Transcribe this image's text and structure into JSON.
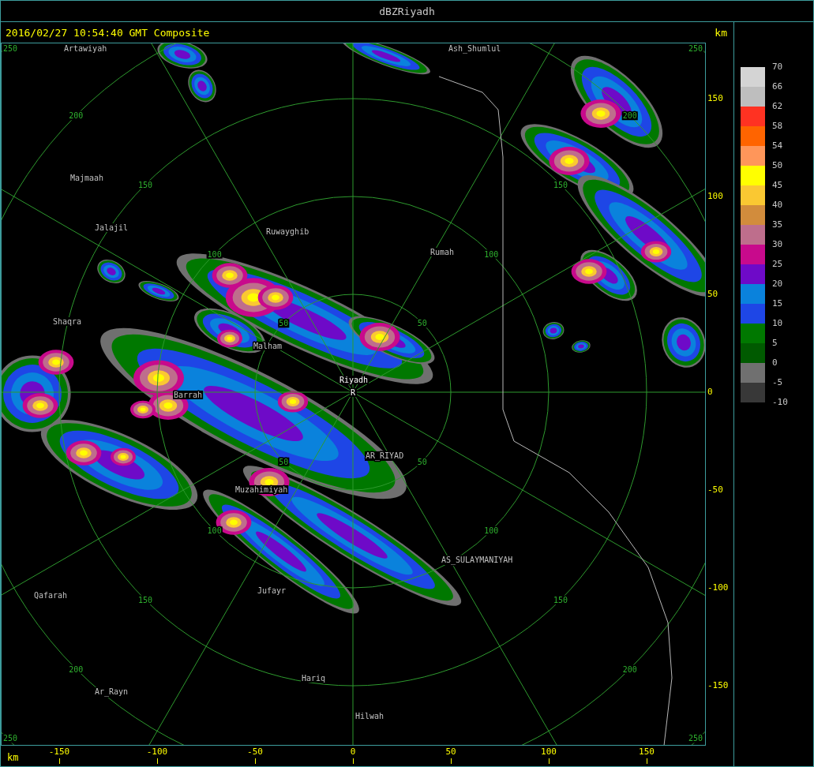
{
  "window": {
    "title": "dBZRiyadh"
  },
  "header": {
    "timestamp": "2016/02/27 10:54:40 GMT Composite",
    "unit": "km"
  },
  "map": {
    "range_rings": [
      {
        "labels": [
          "50",
          "50",
          "50",
          "50"
        ]
      },
      {
        "labels": [
          "100",
          "100",
          "100",
          "100"
        ]
      },
      {
        "labels": [
          "150",
          "150",
          "150",
          "150"
        ]
      },
      {
        "labels": [
          "200",
          "200",
          "200",
          "200"
        ]
      },
      {
        "labels": [
          "250",
          "250",
          "250",
          "250"
        ]
      }
    ],
    "cities": [
      {
        "name": "Artawiyah",
        "kind": "town"
      },
      {
        "name": "Ash_Shumlul",
        "kind": "town"
      },
      {
        "name": "Majmaah",
        "kind": "town"
      },
      {
        "name": "Jalajil",
        "kind": "town"
      },
      {
        "name": "Ruwayghib",
        "kind": "town"
      },
      {
        "name": "Rumah",
        "kind": "town"
      },
      {
        "name": "Shaqra",
        "kind": "town"
      },
      {
        "name": "Malham",
        "kind": "town"
      },
      {
        "name": "Riyadh",
        "kind": "site"
      },
      {
        "name": "Barrah",
        "kind": "town"
      },
      {
        "name": "AR_RIYAD",
        "kind": "town"
      },
      {
        "name": "Muzahimiyah",
        "kind": "town"
      },
      {
        "name": "AS_SULAYMANIYAH",
        "kind": "town"
      },
      {
        "name": "Qafarah",
        "kind": "town"
      },
      {
        "name": "Jufayr",
        "kind": "town"
      },
      {
        "name": "Hariq",
        "kind": "town"
      },
      {
        "name": "Ar_Rayn",
        "kind": "town"
      },
      {
        "name": "Hilwah",
        "kind": "town"
      }
    ],
    "site_marker": "R"
  },
  "y_axis": {
    "ticks": [
      "150",
      "100",
      "50",
      "0",
      "-50",
      "-100",
      "-150"
    ]
  },
  "x_axis": {
    "unit": "km",
    "ticks": [
      "-150",
      "-100",
      "-50",
      "0",
      "50",
      "100",
      "150"
    ]
  },
  "legend": {
    "bins": [
      {
        "color": "#d4d4d4"
      },
      {
        "color": "#bebebe"
      },
      {
        "color": "#ff3222"
      },
      {
        "color": "#ff6400"
      },
      {
        "color": "#ff965a"
      },
      {
        "color": "#ffff00"
      },
      {
        "color": "#fac832"
      },
      {
        "color": "#d28c3c"
      },
      {
        "color": "#be6e8c"
      },
      {
        "color": "#c80a8c"
      },
      {
        "color": "#6e0ac8"
      },
      {
        "color": "#0a82dc"
      },
      {
        "color": "#1e46e6"
      },
      {
        "color": "#007800"
      },
      {
        "color": "#005a00"
      },
      {
        "color": "#707070"
      },
      {
        "color": "#383838"
      }
    ],
    "labels": [
      "70",
      "66",
      "62",
      "58",
      "54",
      "50",
      "45",
      "40",
      "35",
      "30",
      "25",
      "20",
      "15",
      "10",
      "5",
      "0",
      "-5",
      "-10"
    ]
  }
}
